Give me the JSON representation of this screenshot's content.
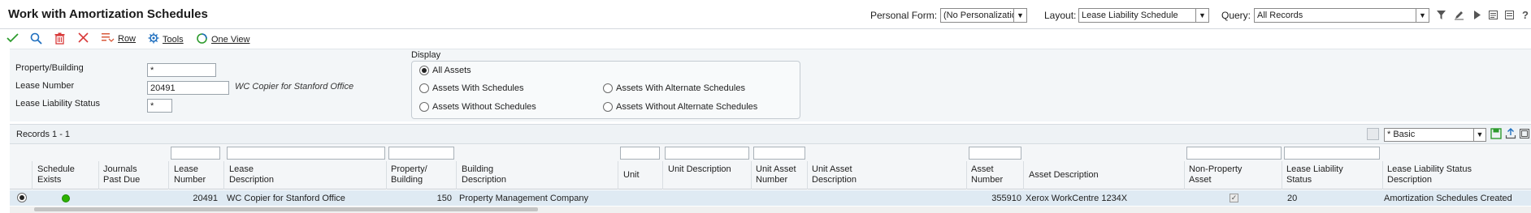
{
  "header": {
    "title": "Work with Amortization Schedules",
    "personal_form_label": "Personal Form:",
    "personal_form_value": "(No Personalization)",
    "layout_label": "Layout:",
    "layout_value": "Lease Liability Schedule",
    "query_label": "Query:",
    "query_value": "All Records",
    "icons": [
      "filter-icon",
      "edit-query-icon",
      "play-icon",
      "report-icon",
      "more-icon",
      "help-icon"
    ]
  },
  "toolbar": {
    "select_icon": "checkmark-icon",
    "find_icon": "search-icon",
    "delete_icon": "trash-icon",
    "close_icon": "close-icon",
    "row_label": "Row",
    "tools_label": "Tools",
    "one_view_label": "One View"
  },
  "filters": {
    "property_building_label": "Property/Building",
    "property_building_value": "*",
    "lease_number_label": "Lease Number",
    "lease_number_value": "20491",
    "lease_number_desc": "WC Copier for Stanford Office",
    "lease_liability_status_label": "Lease Liability Status",
    "lease_liability_status_value": "*"
  },
  "display": {
    "title": "Display",
    "options": [
      {
        "label": "All Assets",
        "selected": true
      },
      {
        "label": "Assets With Schedules",
        "selected": false
      },
      {
        "label": "Assets Without Schedules",
        "selected": false
      },
      {
        "label": "Assets With Alternate Schedules",
        "selected": false
      },
      {
        "label": "Assets Without Alternate Schedules",
        "selected": false
      }
    ]
  },
  "grid": {
    "records_label": "Records 1 - 1",
    "view_select": "* Basic",
    "columns": [
      "Schedule Exists",
      "Journals Past Due",
      "Lease Number",
      "Lease Description",
      "Property/ Building",
      "Building Description",
      "Unit",
      "Unit Description",
      "Unit Asset Number",
      "Unit Asset Description",
      "Asset Number",
      "Asset Description",
      "Non-Property Asset",
      "Lease Liability Status",
      "Lease Liability Status Description"
    ],
    "rows": [
      {
        "schedule_exists": "green",
        "lease_number": "20491",
        "lease_description": "WC Copier for Stanford Office",
        "property_building": "150",
        "building_description": "Property Management Company",
        "asset_number": "355910",
        "asset_description": "Xerox WorkCentre 1234X",
        "non_property_asset": true,
        "lease_liability_status": "20",
        "lease_liability_status_description": "Amortization Schedules Created"
      }
    ]
  },
  "colors": {
    "accent_green": "#2db200",
    "delete_red": "#d83b3b",
    "link_blue": "#1f6fbf",
    "row_selected": "#dfeaf3"
  }
}
